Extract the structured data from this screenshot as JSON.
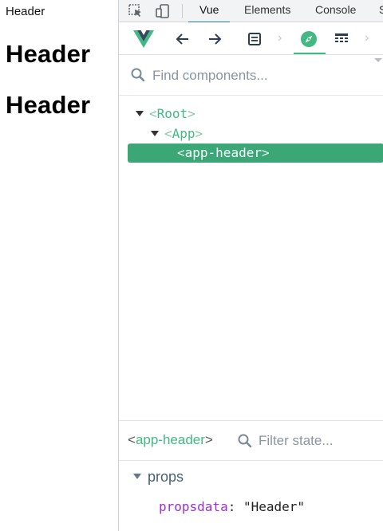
{
  "page": {
    "small_text": "Header",
    "heading_1": "Header",
    "heading_2": "Header"
  },
  "devtools": {
    "tabs": [
      {
        "label": "Vue",
        "active": true
      },
      {
        "label": "Elements",
        "active": false
      },
      {
        "label": "Console",
        "active": false
      },
      {
        "label": "S",
        "active": false
      }
    ],
    "toolbar": {
      "icons": [
        "vue-logo-icon",
        "back-arrow-icon",
        "forward-arrow-icon",
        "components-icon",
        "chevron-right-icon",
        "compass-icon",
        "timeline-icon",
        "chevron-right-icon"
      ],
      "active_color": "#42b983"
    },
    "search": {
      "placeholder": "Find components..."
    },
    "tree": {
      "root": {
        "open": "<",
        "name": "Root",
        "close": ">"
      },
      "app": {
        "open": "<",
        "name": "App",
        "close": ">"
      },
      "selected": {
        "open": "<",
        "name": "app-header",
        "close": ">"
      }
    },
    "inspector": {
      "selected_open": "<",
      "selected_name": "app-header",
      "selected_close": ">",
      "filter_placeholder": "Filter state...",
      "section": "props",
      "prop_key": "propsdata",
      "prop_sep": ": ",
      "prop_value": "\"Header\""
    }
  },
  "colors": {
    "vue_green": "#42b983",
    "selection_bg": "#3ba776",
    "chrome_tab_accent": "#1a73e8"
  }
}
